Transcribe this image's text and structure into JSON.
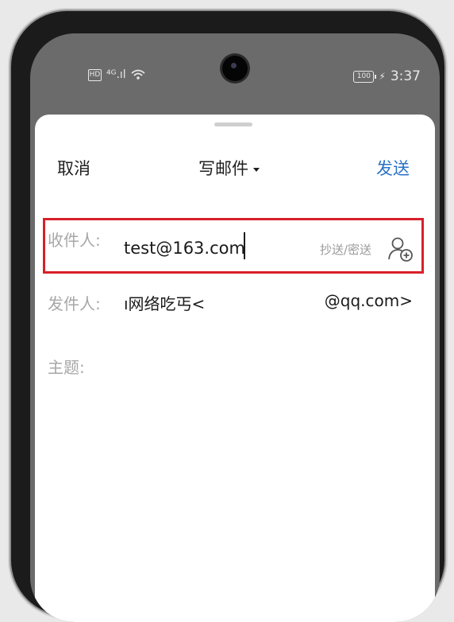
{
  "status_bar": {
    "hd_badge": "HD",
    "signal_text": "⁴ᴳ.ıl",
    "wifi_icon": "wifi-icon",
    "battery": "100",
    "time": "3:37"
  },
  "toolbar": {
    "cancel_label": "取消",
    "title": "写邮件",
    "send_label": "发送"
  },
  "to": {
    "label": "收件人:",
    "value": "test@163.com",
    "cc_bcc": "抄送/密送"
  },
  "from": {
    "label": "发件人:",
    "name": "ı网络吃丐<",
    "email": "@qq.com>"
  },
  "subject": {
    "label": "主题:"
  },
  "colors": {
    "accent": "#2a72c8",
    "highlight_box": "#d8202a",
    "label_gray": "#a7a7a7"
  }
}
